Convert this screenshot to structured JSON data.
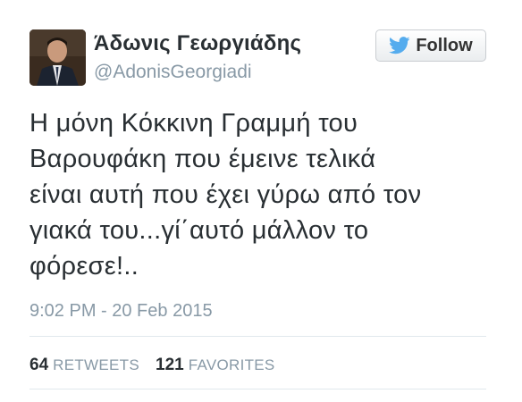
{
  "author": {
    "display_name": "Άδωνις Γεωργιάδης",
    "handle": "@AdonisGeorgiadi",
    "avatar": "profile-photo"
  },
  "follow_button": {
    "label": "Follow",
    "icon": "twitter-bird-icon",
    "icon_color": "#55acee"
  },
  "tweet": {
    "text": "Η μόνη Κόκκινη Γραμμή του\nΒαρουφάκη που έμεινε τελικά\nείναι αυτή που έχει γύρω από τον\nγιακά του...γί΄αυτό μάλλον το\nφόρεσε!..",
    "timestamp": "9:02 PM - 20 Feb 2015"
  },
  "stats": {
    "retweets": {
      "count": "64",
      "label": "RETWEETS"
    },
    "favorites": {
      "count": "121",
      "label": "FAVORITES"
    }
  },
  "colors": {
    "text": "#292f33",
    "muted": "#8899a6",
    "divider": "#e1e8ed"
  }
}
